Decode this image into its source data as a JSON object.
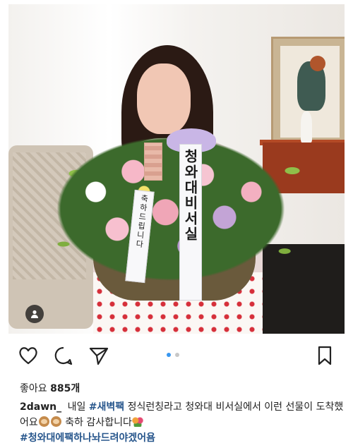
{
  "post": {
    "ribbons": {
      "left_text": "축하드립니다",
      "right_text": "청와대비서실"
    },
    "likes": {
      "label": "좋아요",
      "count": "885개"
    },
    "caption": {
      "username": "2dawn_",
      "text_1": "내일",
      "hashtag_1": "#새벽팩",
      "text_2": "정식런칭라고 청와대 비서실에서 이런 선물이 도착했어요",
      "text_3": "축하 감사합니다",
      "hashtag_2": "#청와대에팩하나놔드려야겠어욤"
    },
    "carousel": {
      "total": 2,
      "active_index": 0
    }
  },
  "icons": {
    "like": "heart-icon",
    "comment": "comment-icon",
    "share": "share-icon",
    "save": "bookmark-icon",
    "tag": "person-tag-icon",
    "emoji": "monkey-emoji-icon",
    "bouquet": "bouquet-emoji-icon"
  },
  "colors": {
    "hashtag": "#27568c",
    "carousel_active": "#3897f0",
    "carousel_inactive": "#c7c7c7"
  }
}
